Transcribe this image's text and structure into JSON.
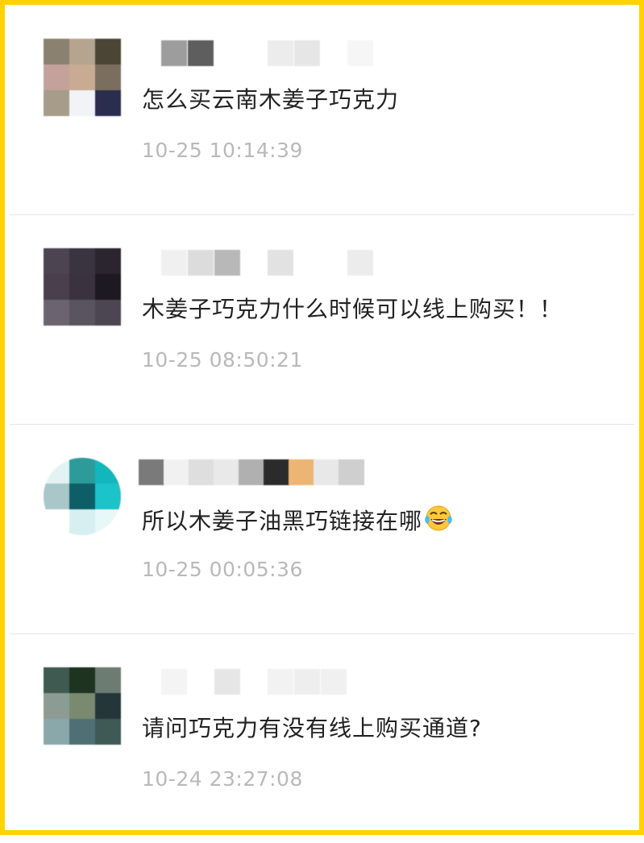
{
  "comments": [
    {
      "text": "怎么买云南木姜子巧克力",
      "time": "10-25 10:14:39",
      "avatar_colors": [
        "#8a8170",
        "#b5a58e",
        "#4a4535",
        "#c3a29b",
        "#c7ab93",
        "#7b6e5e",
        "#a79b8a",
        "#f1f3f7",
        "#2b2d4f"
      ],
      "name_blocks": [
        "#9d9d9d",
        "#5e5e5e",
        "#ffffff",
        "#ffffff",
        "#ececec",
        "#e6e6e6",
        "#ffffff",
        "#f6f6f6"
      ]
    },
    {
      "text": "木姜子巧克力什么时候可以线上购买！！",
      "time": "10-25 08:50:21",
      "avatar_colors": [
        "#4d4452",
        "#3a3340",
        "#2b2530",
        "#4a3f4c",
        "#3a323e",
        "#1d1922",
        "#6b6470",
        "#5a5360",
        "#4c4552"
      ],
      "name_blocks": [
        "#f0f0f0",
        "#dcdcdc",
        "#b8b8b8",
        "#ffffff",
        "#e2e2e2",
        "#ffffff",
        "#ffffff",
        "#ececec"
      ]
    },
    {
      "text": "所以木姜子油黑巧链接在哪",
      "emoji": "laughing-tears",
      "time": "10-25 00:05:36",
      "avatar_colors": [
        "#e3f3f3",
        "#2e9b9b",
        "#12b6bd",
        "#a9c6c9",
        "#0e5e68",
        "#1cc3c9",
        "#ffffff",
        "#d7eff0",
        "#e8f7f7"
      ],
      "name_blocks": [
        "#7a7a7a",
        "#f1f1f1",
        "#dedede",
        "#e9e9e9",
        "#b0b0b0",
        "#2b2b2b",
        "#ecb573",
        "#e8e8e8",
        "#cfcfcf"
      ]
    },
    {
      "text": "请问巧克力有没有线上购买通道?",
      "time": "10-24 23:27:08",
      "avatar_colors": [
        "#3f5a50",
        "#1e3320",
        "#6c7c72",
        "#8c9c94",
        "#7a8a70",
        "#24363a",
        "#8aa8aa",
        "#4f6f75",
        "#3f5a55"
      ],
      "name_blocks": [
        "#f4f4f4",
        "#ffffff",
        "#e6e6e6",
        "#ffffff",
        "#f2f2f2",
        "#eeeeee",
        "#f0f0f0",
        "#ffffff"
      ]
    }
  ]
}
